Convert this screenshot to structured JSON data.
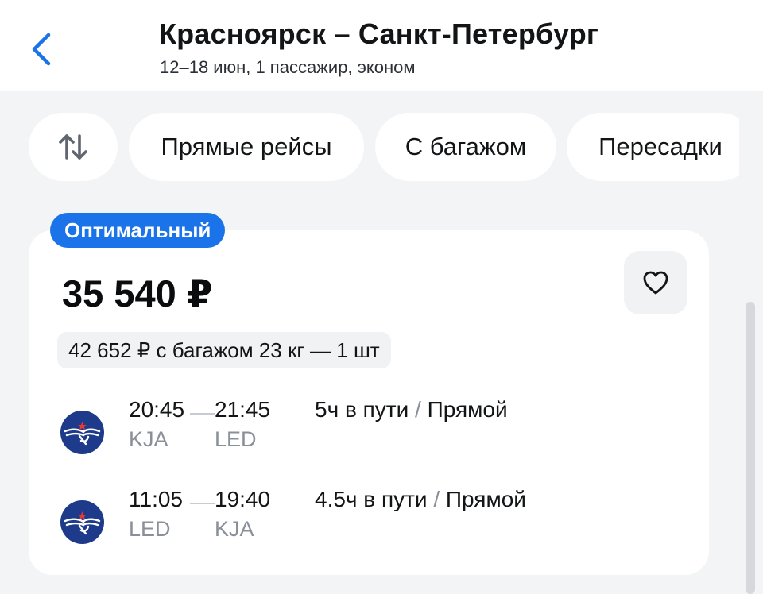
{
  "header": {
    "title": "Красноярск – Санкт-Петербург",
    "subtitle": "12–18 июн, 1 пассажир, эконом"
  },
  "filters": {
    "sort_icon": "sort-arrows-icon",
    "chips": [
      "Прямые рейсы",
      "С багажом",
      "Пересадки"
    ]
  },
  "card": {
    "badge": "Оптимальный",
    "price": "35 540 ₽",
    "baggage_price": "42 652 ₽ с багажом 23 кг — 1 шт",
    "segments": [
      {
        "airline_logo": "aeroflot-logo",
        "departure_time": "20:45",
        "arrival_time": "21:45",
        "departure_code": "KJA",
        "arrival_code": "LED",
        "duration": "5ч в пути",
        "separator": " / ",
        "stops": "Прямой"
      },
      {
        "airline_logo": "aeroflot-logo",
        "departure_time": "11:05",
        "arrival_time": "19:40",
        "departure_code": "LED",
        "arrival_code": "KJA",
        "duration": "4.5ч в пути",
        "separator": " / ",
        "stops": "Прямой"
      }
    ]
  },
  "colors": {
    "accent": "#1a73e8",
    "badge_bg": "#1a73e8",
    "muted_text": "#8a9099",
    "logo_bg": "#1e3a8a"
  }
}
